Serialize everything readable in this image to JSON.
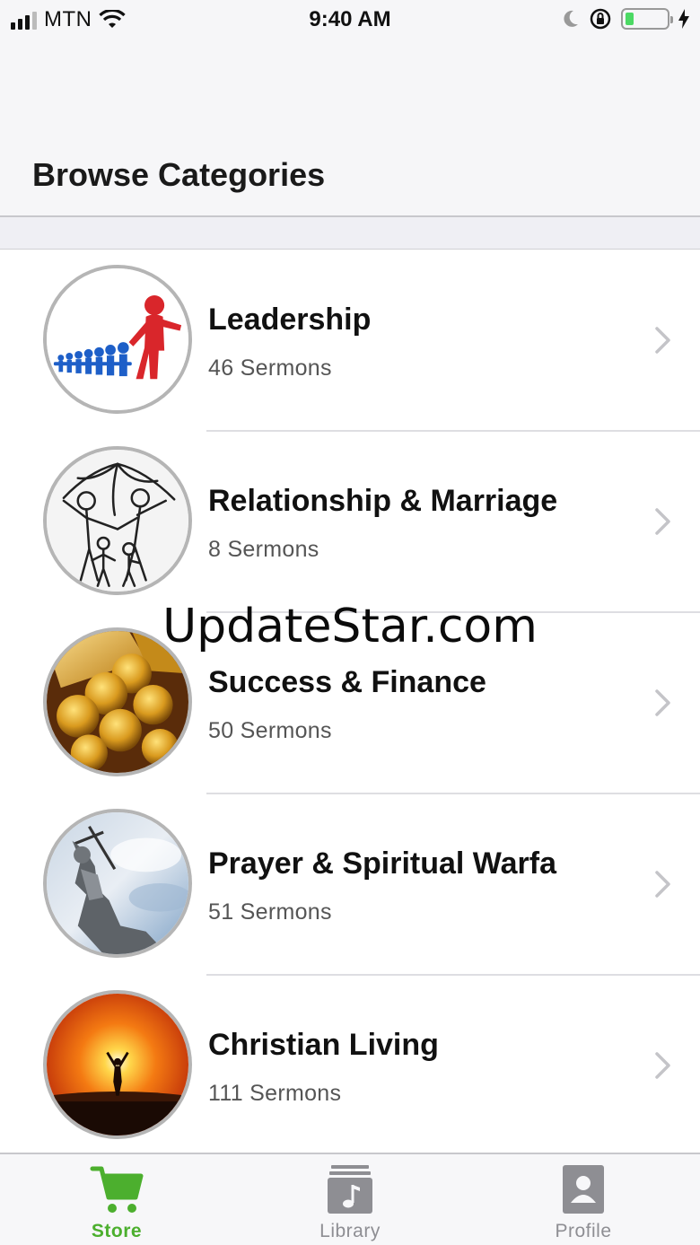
{
  "status_bar": {
    "carrier": "MTN",
    "time": "9:40 AM",
    "battery_level": 0.2
  },
  "header": {
    "title": "Browse Categories"
  },
  "categories": [
    {
      "title": "Leadership",
      "count": "46 Sermons",
      "image": "leadership-figures"
    },
    {
      "title": "Relationship & Marriage",
      "count": "8 Sermons",
      "image": "family-sketch"
    },
    {
      "title": "Success & Finance",
      "count": "50 Sermons",
      "image": "gold-coins"
    },
    {
      "title": "Prayer & Spiritual Warfa",
      "count": "51 Sermons",
      "image": "warrior-statue"
    },
    {
      "title": "Christian Living",
      "count": "111 Sermons",
      "image": "sunrise-silhouette"
    }
  ],
  "watermark": "UpdateStar.com",
  "tab_bar": {
    "tabs": [
      {
        "label": "Store",
        "icon": "cart-icon",
        "active": true
      },
      {
        "label": "Library",
        "icon": "music-library-icon",
        "active": false
      },
      {
        "label": "Profile",
        "icon": "contact-icon",
        "active": false
      }
    ],
    "active_color": "#4caf2e",
    "inactive_color": "#8e8e93"
  }
}
